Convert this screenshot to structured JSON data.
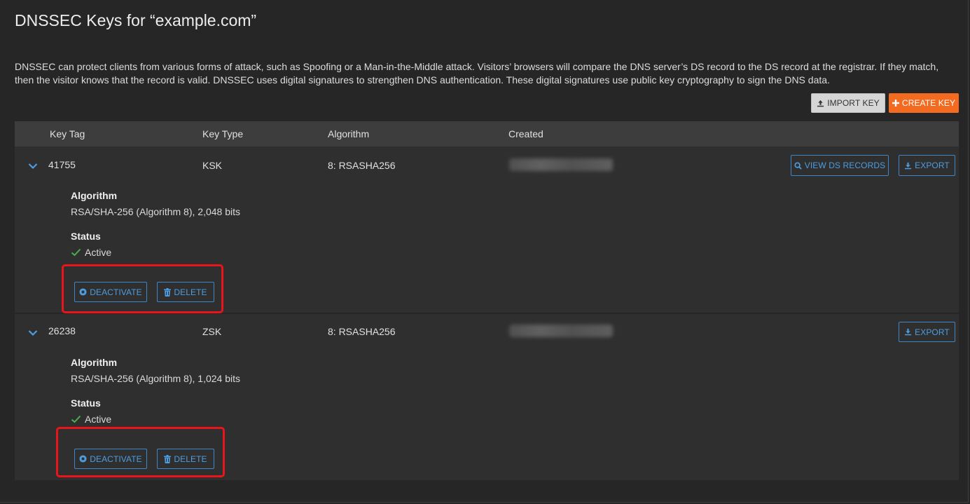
{
  "page": {
    "title": "DNSSEC Keys for “example.com”",
    "description": "DNSSEC can protect clients from various forms of attack, such as Spoofing or a Man-in-the-Middle attack. Visitors’ browsers will compare the DNS server’s DS record to the DS record at the registrar. If they match, then the visitor knows that the record is valid. DNSSEC uses digital signatures to strengthen DNS authentication. These digital signatures use public key cryptography to sign the DNS data."
  },
  "toolbar": {
    "import_label": "IMPORT KEY",
    "create_label": "CREATE KEY",
    "import_icon": "upload-icon",
    "create_icon": "plus-icon"
  },
  "table": {
    "headers": [
      "Key Tag",
      "Key Type",
      "Algorithm",
      "Created"
    ],
    "rows": [
      {
        "key_tag": "41755",
        "key_type": "KSK",
        "algorithm": "8: RSASHA256",
        "algorithm_label": "Algorithm",
        "algorithm_detail": "RSA/SHA-256 (Algorithm 8), 2,048 bits",
        "status_label": "Status",
        "status": "Active",
        "view_ds_label": "VIEW DS RECORDS",
        "export_label": "EXPORT",
        "deactivate_label": "DEACTIVATE",
        "delete_label": "DELETE"
      },
      {
        "key_tag": "26238",
        "key_type": "ZSK",
        "algorithm": "8: RSASHA256",
        "algorithm_label": "Algorithm",
        "algorithm_detail": "RSA/SHA-256 (Algorithm 8), 1,024 bits",
        "status_label": "Status",
        "status": "Active",
        "export_label": "EXPORT",
        "deactivate_label": "DEACTIVATE",
        "delete_label": "DELETE"
      }
    ]
  },
  "colors": {
    "background": "#262626",
    "row": "#2f2f2f",
    "header": "#3d3d3d",
    "accent": "#4d9de0",
    "primary": "#f26b21",
    "success": "#4caf50",
    "highlight": "#e8161b"
  }
}
